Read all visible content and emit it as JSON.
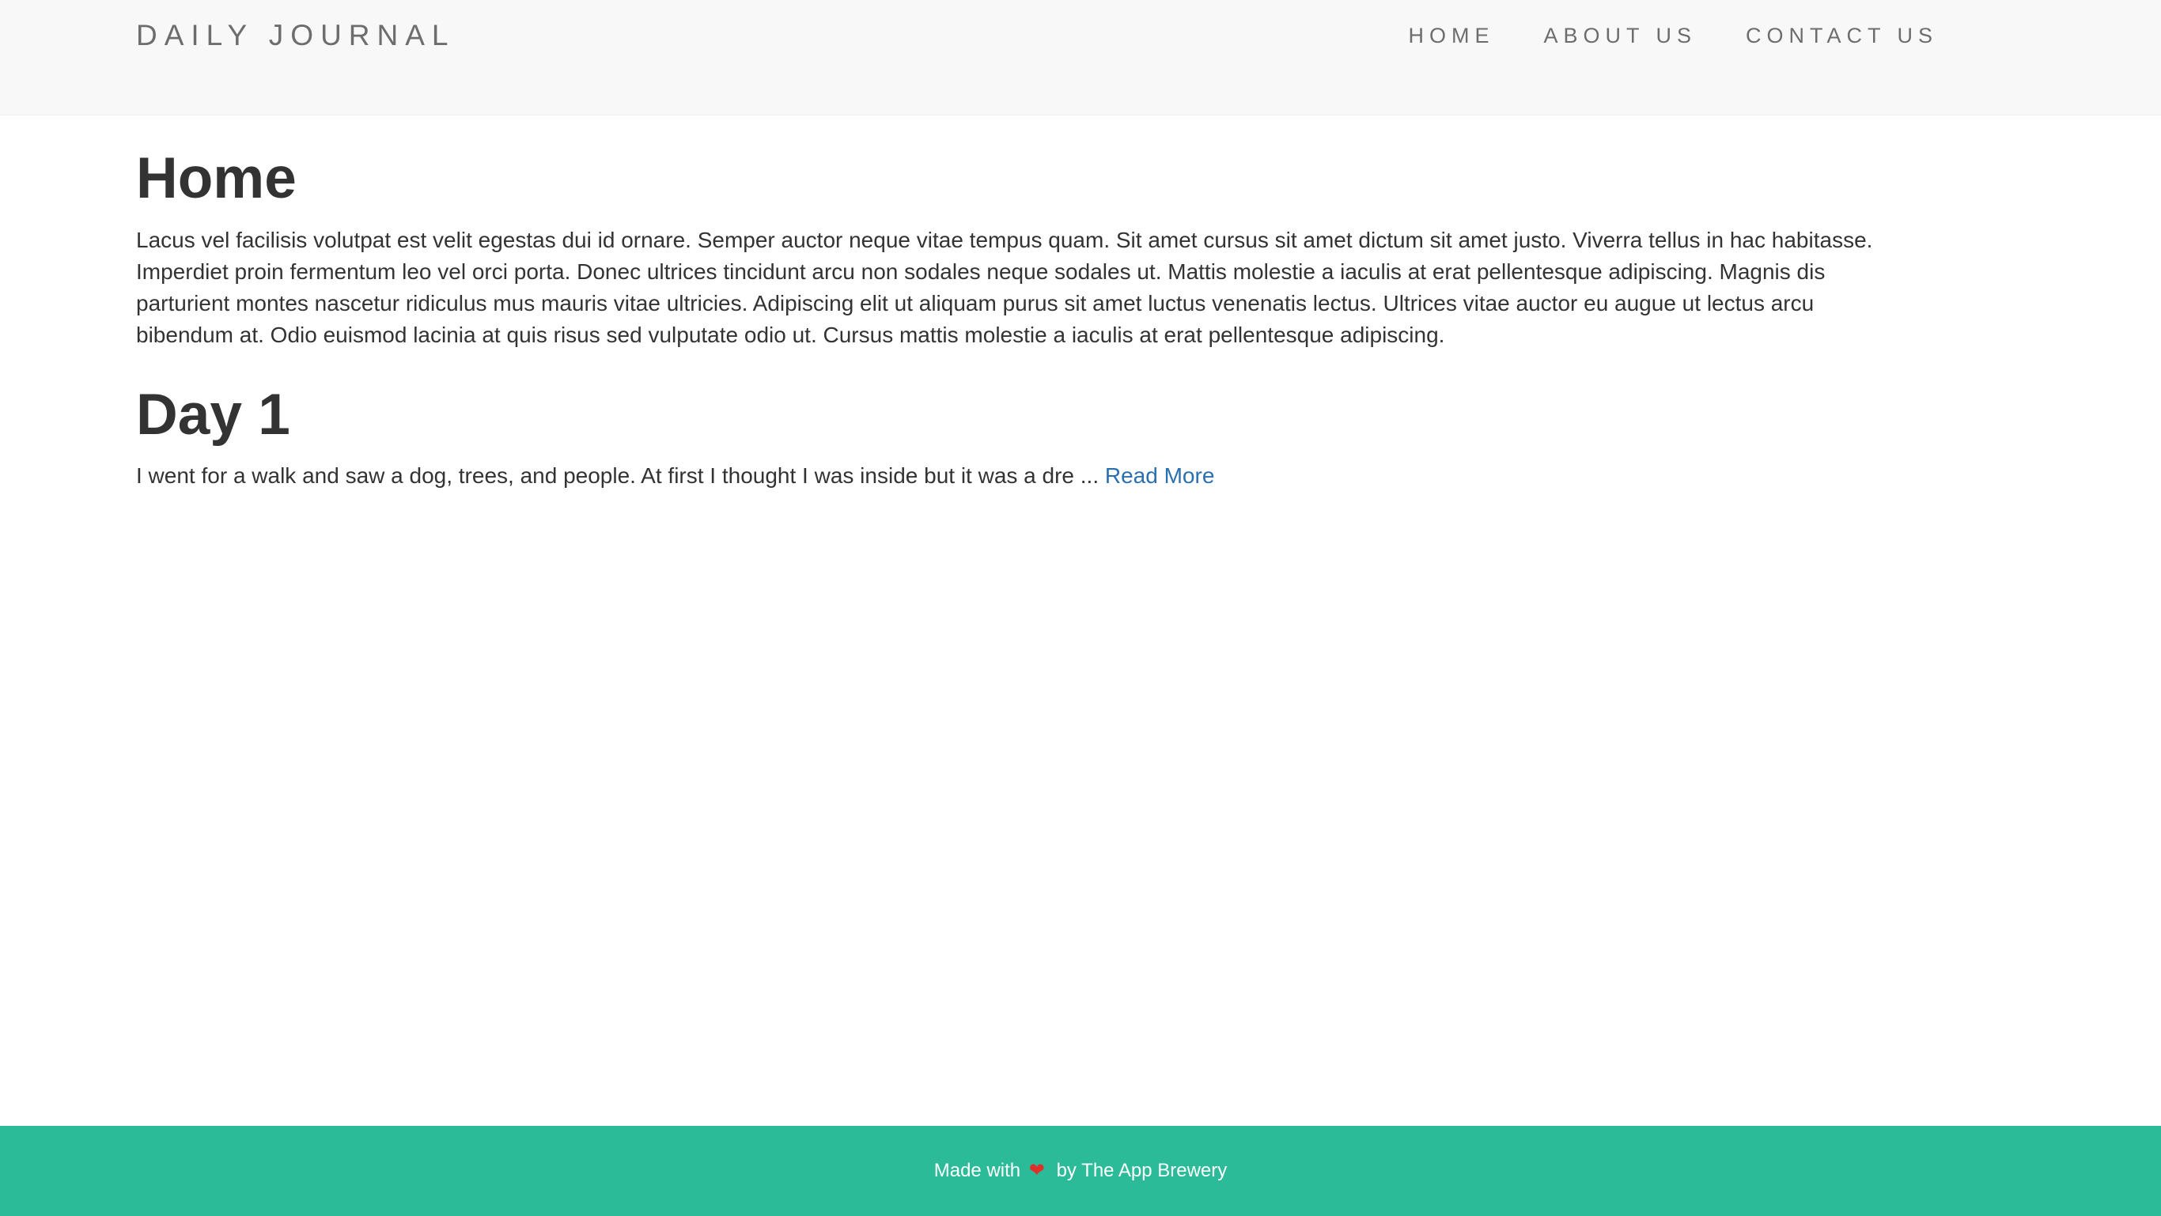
{
  "navbar": {
    "brand": "DAILY JOURNAL",
    "links": [
      "HOME",
      "ABOUT US",
      "CONTACT US"
    ]
  },
  "home": {
    "title": "Home",
    "body": "Lacus vel facilisis volutpat est velit egestas dui id ornare. Semper auctor neque vitae tempus quam. Sit amet cursus sit amet dictum sit amet justo. Viverra tellus in hac habitasse. Imperdiet proin fermentum leo vel orci porta. Donec ultrices tincidunt arcu non sodales neque sodales ut. Mattis molestie a iaculis at erat pellentesque adipiscing. Magnis dis parturient montes nascetur ridiculus mus mauris vitae ultricies. Adipiscing elit ut aliquam purus sit amet luctus venenatis lectus. Ultrices vitae auctor eu augue ut lectus arcu bibendum at. Odio euismod lacinia at quis risus sed vulputate odio ut. Cursus mattis molestie a iaculis at erat pellentesque adipiscing."
  },
  "posts": [
    {
      "title": "Day 1",
      "excerpt": "I went for a walk and saw a dog, trees, and people. At first I thought I was inside but it was a dre ... ",
      "read_more": "Read More"
    }
  ],
  "footer": {
    "made_with": "Made with",
    "heart": "❤",
    "by": "by The App Brewery"
  },
  "colors": {
    "navbar_bg": "#f8f8f8",
    "footer_bg": "#2bbb99",
    "link": "#2a6fb0",
    "heart": "#e0302a"
  }
}
